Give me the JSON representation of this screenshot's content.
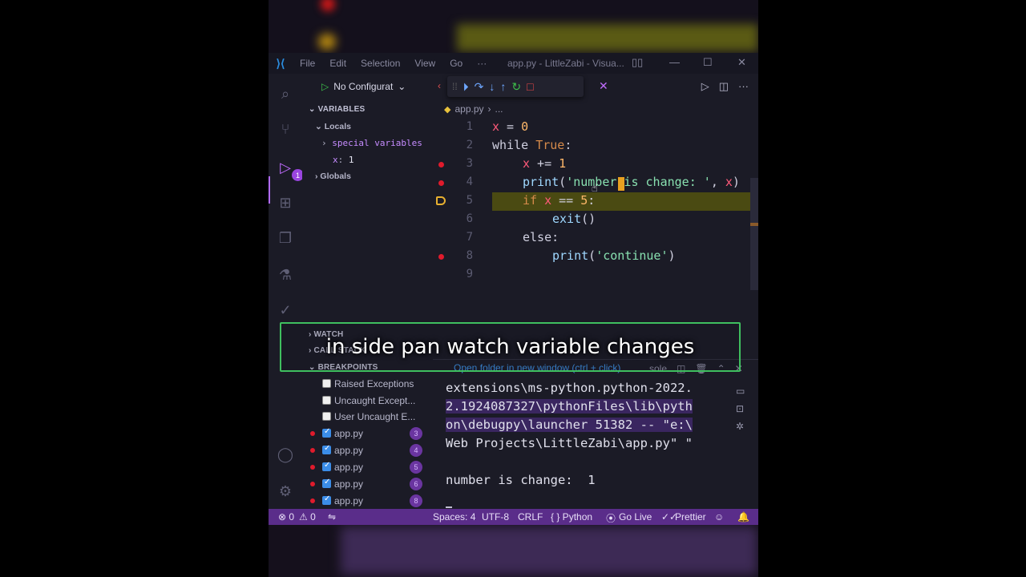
{
  "titlebar": {
    "menu": [
      "File",
      "Edit",
      "Selection",
      "View",
      "Go",
      "···"
    ],
    "window_title": "app.py - LittleZabi - Visua...",
    "min": "—",
    "max": "☐",
    "close": "✕"
  },
  "debug": {
    "config_label": "No Configurat",
    "toolbar_icons": [
      "grip-icon",
      "continue-icon",
      "step-over-icon",
      "step-into-icon",
      "step-out-icon",
      "restart-icon",
      "stop-icon"
    ]
  },
  "activity": {
    "debug_badge": "1"
  },
  "variables": {
    "header": "VARIABLES",
    "locals": "Locals",
    "special": "special variables",
    "x_name": "x",
    "x_value": "1",
    "globals": "Globals"
  },
  "watch": {
    "header": "WATCH"
  },
  "callstack": {
    "header": "CALL STACK"
  },
  "breakpoints": {
    "header": "BREAKPOINTS",
    "items": [
      {
        "label": "Raised Exceptions",
        "checked": false,
        "line": ""
      },
      {
        "label": "Uncaught Except...",
        "checked": false,
        "line": ""
      },
      {
        "label": "User Uncaught E...",
        "checked": false,
        "line": ""
      },
      {
        "label": "app.py",
        "checked": true,
        "line": "3"
      },
      {
        "label": "app.py",
        "checked": true,
        "line": "4"
      },
      {
        "label": "app.py",
        "checked": true,
        "line": "5"
      },
      {
        "label": "app.py",
        "checked": true,
        "line": "6"
      },
      {
        "label": "app.py",
        "checked": true,
        "line": "8"
      }
    ]
  },
  "editor": {
    "breadcrumb_file": "app.py",
    "breadcrumb_more": "...",
    "lines": [
      "1",
      "2",
      "3",
      "4",
      "5",
      "6",
      "7",
      "8",
      "9"
    ],
    "code": {
      "l1_var": "x",
      "l1_rest": " = ",
      "l1_num": "0",
      "l2_kw": "while",
      "l2_true": "True",
      "l2_colon": ":",
      "l3_var": "x",
      "l3_rest": " += ",
      "l3_num": "1",
      "l4_fn": "print",
      "l4_open": "(",
      "l4_str": "'number is change: '",
      "l4_comma": ", ",
      "l4_var": "x",
      "l4_close": ")",
      "l5_kw": "if",
      "l5_var": "x",
      "l5_rest": " == ",
      "l5_num": "5",
      "l5_colon": ":",
      "l6_fn": "exit",
      "l6_paren": "()",
      "l7_kw": "else",
      "l7_colon": ":",
      "l8_fn": "print",
      "l8_open": "(",
      "l8_str": "'continue'",
      "l8_close": ")"
    }
  },
  "panel": {
    "tooltip": "Open folder in new window (ctrl + click)",
    "console_tab": "sole",
    "terminal_lines": [
      "extensions\\ms-python.python-2022.",
      "2.1924087327\\pythonFiles\\lib\\pyth",
      "on\\debugpy\\launcher 51382 -- \"e:\\",
      "Web Projects\\LittleZabi\\app.py\" \"",
      "",
      "number is change:  1"
    ]
  },
  "statusbar": {
    "errors": "⊗ 0",
    "warnings": "⚠ 0",
    "spaces": "Spaces: 4",
    "encoding": "UTF-8",
    "eol": "CRLF",
    "language": "{ }  Python",
    "golive": "Go Live",
    "prettier": "Prettier"
  },
  "caption": {
    "text": "in side pan watch variable changes"
  },
  "colors": {
    "accent": "#5a2d8a",
    "breakpoint": "#e01b2c",
    "current_line": "#4a4a12",
    "caption_border": "#3fbf5f"
  }
}
